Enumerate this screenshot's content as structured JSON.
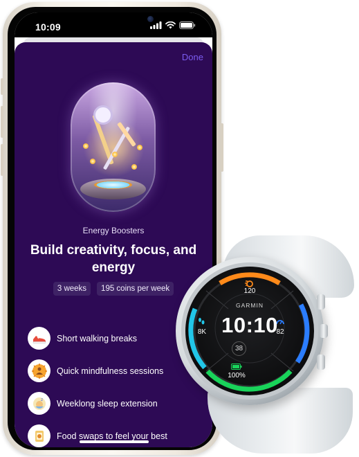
{
  "phone": {
    "status_time": "10:09",
    "done_label": "Done",
    "section_label": "Energy Boosters",
    "headline": "Build creativity, focus, and energy",
    "chips": {
      "duration": "3 weeks",
      "coins": "195 coins per week"
    },
    "activities": [
      {
        "label": "Short walking breaks",
        "icon": "sneaker-icon"
      },
      {
        "label": "Quick mindfulness sessions",
        "icon": "meditation-icon"
      },
      {
        "label": "Weeklong sleep extension",
        "icon": "sleep-icon"
      },
      {
        "label": "Food swaps to feel your best",
        "icon": "food-icon"
      }
    ],
    "colors": {
      "background": "#2d0a55",
      "accent": "#7b5cf0",
      "chip": "#3e2265"
    }
  },
  "watch": {
    "brand": "GARMIN",
    "time": "10:10",
    "calories": "120",
    "steps": "8K",
    "intensity_minutes": "82",
    "date": "38",
    "battery": "100%",
    "colors": {
      "orange": "#ff8a1a",
      "blue": "#2b7dff",
      "green": "#19d35a",
      "cyan": "#22c6e8",
      "yellow": "#f5c518"
    }
  }
}
